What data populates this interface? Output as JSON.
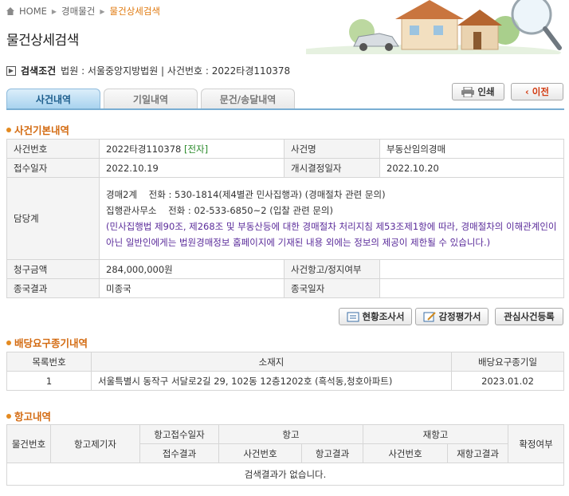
{
  "breadcrumb": {
    "home": "HOME",
    "level1": "경매물건",
    "current": "물건상세검색"
  },
  "page_title": "물건상세검색",
  "search_condition": {
    "label": "검색조건",
    "text": "법원 : 서울중앙지방법원  |  사건번호 : 2022타경110378"
  },
  "buttons": {
    "print": "인쇄",
    "back": "이전",
    "status_report": "현황조사서",
    "appraisal": "감정평가서",
    "watch": "관심사건등록"
  },
  "tabs": [
    {
      "label": "사건내역",
      "active": true
    },
    {
      "label": "기일내역",
      "active": false
    },
    {
      "label": "문건/송달내역",
      "active": false
    }
  ],
  "case_basic": {
    "title": "사건기본내역",
    "case_number_label": "사건번호",
    "case_number": "2022타경110378",
    "electronic_tag": "[전자]",
    "case_name_label": "사건명",
    "case_name": "부동산임의경매",
    "receipt_date_label": "접수일자",
    "receipt_date": "2022.10.19",
    "commence_date_label": "개시결정일자",
    "commence_date": "2022.10.20",
    "dept_label": "담당계",
    "dept_line1": "경매2계    전화 : 530-1814(제4별관 민사집행과) (경매절차 관련 문의)",
    "dept_line2": "집행관사무소    전화 : 02-533-6850~2 (입찰 관련 문의)",
    "dept_notice": "(민사집행법 제90조, 제268조 및 부동산등에 대한 경매절차 처리지침 제53조제1항에 따라, 경매절차의 이해관계인이 아닌 일반인에게는 법원경매정보 홈페이지에 기재된 내용 외에는 정보의 제공이 제한될 수 있습니다.)",
    "claim_label": "청구금액",
    "claim_amount": "284,000,000원",
    "appeal_stop_label": "사건항고/정지여부",
    "appeal_stop": "",
    "final_result_label": "종국결과",
    "final_result": "미종국",
    "final_date_label": "종국일자",
    "final_date": ""
  },
  "dividend": {
    "title": "배당요구종기내역",
    "headers": [
      "목록번호",
      "소재지",
      "배당요구종기일"
    ],
    "rows": [
      {
        "no": "1",
        "address": "서울특별시 동작구 서달로2길 29, 102동 12층1202호 (흑석동,청호아파트)",
        "deadline": "2023.01.02"
      }
    ]
  },
  "appeal": {
    "title": "항고내역",
    "headers": {
      "item_no": "물건번호",
      "filer": "항고제기자",
      "appeal_date": "항고접수일자",
      "receipt_result": "접수결과",
      "appeal": "항고",
      "case_no": "사건번호",
      "appeal_result": "항고결과",
      "reappeal": "재항고",
      "re_case_no": "사건번호",
      "reappeal_result": "재항고결과",
      "confirmed": "확정여부"
    },
    "empty_message": "검색결과가 없습니다."
  },
  "icons": [
    "home-icon",
    "house-illustration",
    "car-illustration",
    "magnifier-illustration",
    "printer-icon",
    "chevron-left-icon",
    "document-icon",
    "pencil-icon"
  ]
}
